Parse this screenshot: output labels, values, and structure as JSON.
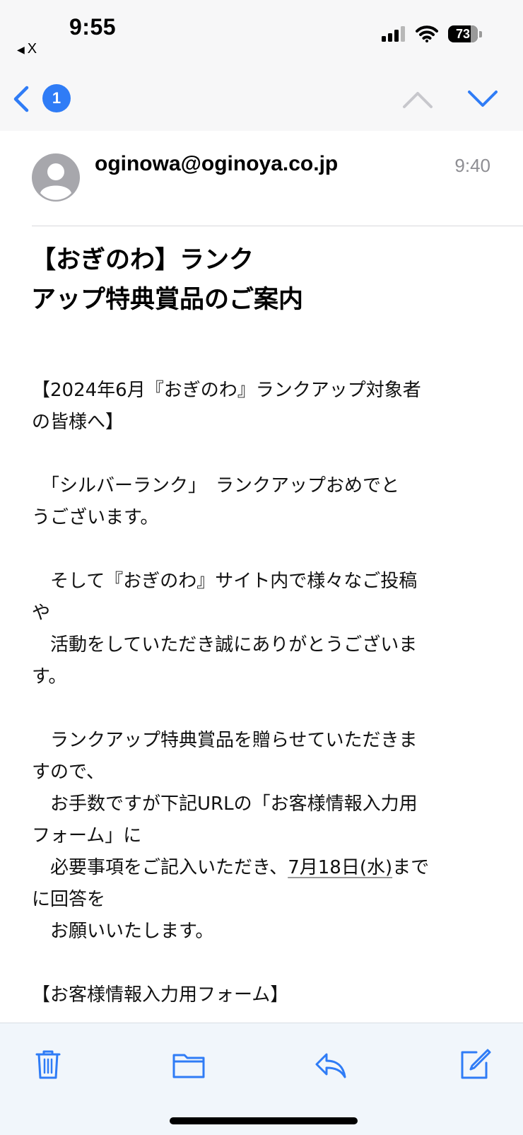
{
  "status_bar": {
    "time": "9:55",
    "back_label": "X",
    "battery": "73"
  },
  "nav": {
    "unread_count": "1"
  },
  "message": {
    "sender": "oginowa@oginoya.co.jp",
    "time": "9:40",
    "subject_lines": [
      "【おぎのわ】ランク",
      "アップ特典賞品のご案内"
    ],
    "body": {
      "l1": "【2024年6月『おぎのわ』ランクアップ対象者",
      "l2": "の皆様へ】",
      "l3": "　「シルバーランク」　ランクアップおめでと",
      "l4": "うございます。",
      "l5": "　そして『おぎのわ』サイト内で様々なご投稿",
      "l6": "や",
      "l7": "　活動をしていただき誠にありがとうございま",
      "l8": "す。",
      "l9": "　ランクアップ特典賞品を贈らせていただきま",
      "l10": "すので、",
      "l11": "　お手数ですが下記URLの「お客様情報入力用",
      "l12": "フォーム」に",
      "l13_pre": "　必要事項をご記入いただき、",
      "l13_date": "7月18日(水)",
      "l13_post": "まで",
      "l14": "に回答を",
      "l15": "　お願いいたします。",
      "l16": "【お客様情報入力用フォーム】"
    }
  },
  "toolbar": {
    "icons": [
      "trash-icon",
      "folder-icon",
      "reply-icon",
      "compose-icon"
    ]
  },
  "colors": {
    "accent": "#2f7cf6",
    "muted": "#8e8e93"
  }
}
